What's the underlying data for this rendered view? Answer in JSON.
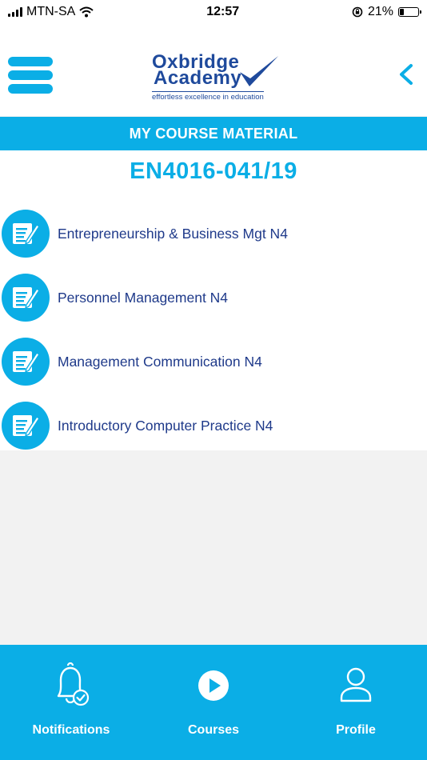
{
  "status_bar": {
    "carrier": "MTN-SA",
    "time": "12:57",
    "battery_percent": "21%",
    "battery_level": 0.21
  },
  "header": {
    "logo_line1": "Oxbridge",
    "logo_line2": "Academy",
    "logo_tagline": "effortless excellence in education"
  },
  "banner": {
    "title": "MY COURSE MATERIAL"
  },
  "course_code": "EN4016-041/19",
  "courses": [
    {
      "label": "Entrepreneurship & Business Mgt N4",
      "icon": "document-pencil-icon"
    },
    {
      "label": "Personnel Management N4",
      "icon": "document-pencil-icon"
    },
    {
      "label": "Management Communication N4",
      "icon": "document-pencil-icon"
    },
    {
      "label": "Introductory Computer Practice N4",
      "icon": "document-pencil-icon"
    }
  ],
  "tabbar": {
    "tabs": [
      {
        "label": "Notifications",
        "icon": "bell-check-icon"
      },
      {
        "label": "Courses",
        "icon": "play-circle-icon"
      },
      {
        "label": "Profile",
        "icon": "user-icon"
      }
    ]
  },
  "colors": {
    "accent": "#0baee6",
    "brand_navy": "#1f4a9c",
    "text_navy": "#1f3a8a"
  }
}
